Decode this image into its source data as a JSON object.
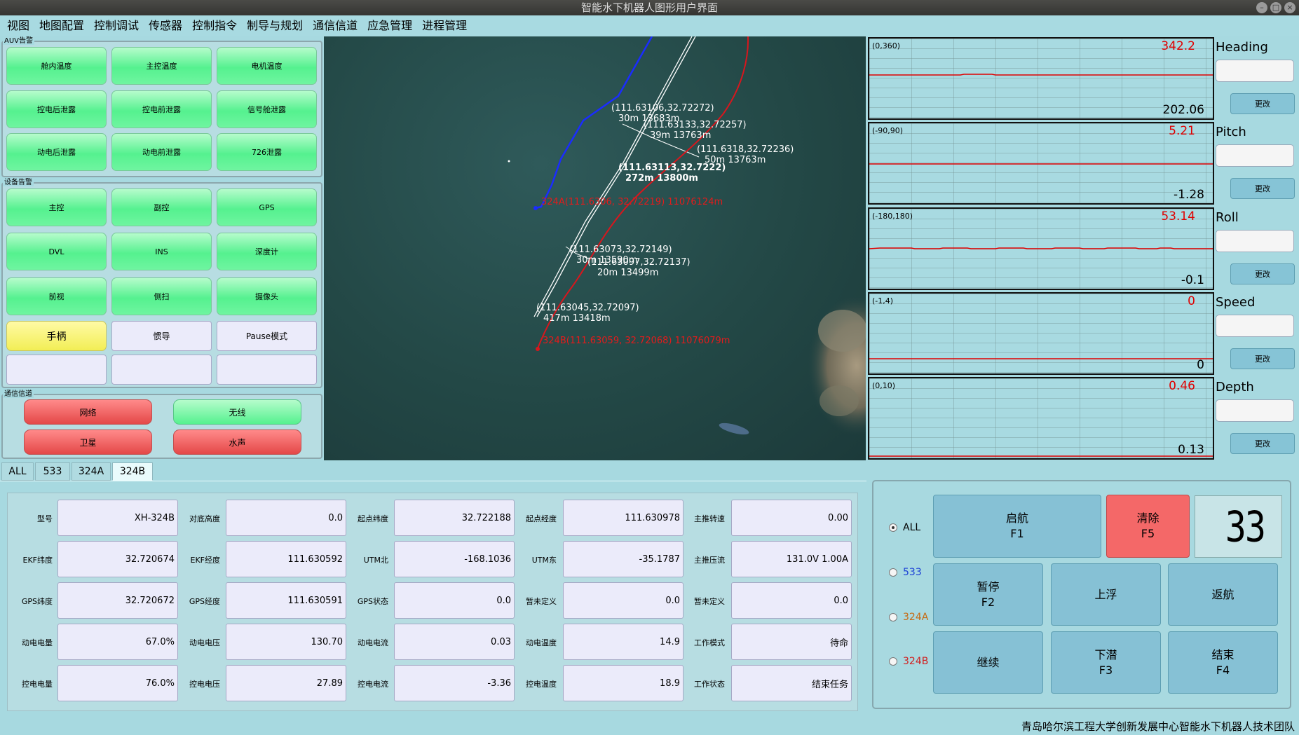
{
  "window": {
    "title": "智能水下机器人图形用户界面"
  },
  "menu": [
    "视图",
    "地图配置",
    "控制调试",
    "传感器",
    "控制指令",
    "制导与规划",
    "通信信道",
    "应急管理",
    "进程管理"
  ],
  "auv_alarm": {
    "title": "AUV告警",
    "buttons": [
      "舱内温度",
      "主控温度",
      "电机温度",
      "控电后泄露",
      "控电前泄露",
      "信号舱泄露",
      "动电后泄露",
      "动电前泄露",
      "726泄露"
    ]
  },
  "device_alarm": {
    "title": "设备告警",
    "buttons": [
      "主控",
      "副控",
      "GPS",
      "DVL",
      "INS",
      "深度计",
      "前视",
      "侧扫",
      "摄像头"
    ],
    "mode_buttons": [
      "手柄",
      "惯导",
      "Pause模式"
    ],
    "empty_buttons": [
      "",
      "",
      ""
    ]
  },
  "comm": {
    "title": "通信信道",
    "buttons": [
      {
        "label": "网络",
        "status": "red"
      },
      {
        "label": "无线",
        "status": "green"
      },
      {
        "label": "卫星",
        "status": "red"
      },
      {
        "label": "水声",
        "status": "red"
      }
    ]
  },
  "map": {
    "labels": [
      {
        "coord": "(111.63106,32.72272)",
        "info": "30m   13683m"
      },
      {
        "coord": "(111.63133,32.72257)",
        "info": "39m  13763m"
      },
      {
        "coord": "(111.6318,32.72236)",
        "info": "50m  13763m"
      },
      {
        "coord": "(111.63113,32.7222)",
        "info": "272m  13800m"
      },
      {
        "coord": "(111.63073,32.72149)",
        "info": "30m  13590m"
      },
      {
        "coord": "(111.63097,32.72137)",
        "info": "20m  13499m"
      },
      {
        "coord": "(111.63045,32.72097)",
        "info": "417m  13418m"
      }
    ],
    "vehicles": [
      {
        "text": "324A(111.6306, 32.72219) 11076124m"
      },
      {
        "text": "324B(111.63059, 32.72068) 11076079m"
      }
    ]
  },
  "sensors": [
    {
      "name": "Heading",
      "range": "(0,360)",
      "max": "342.2",
      "min": "202.06",
      "button": "更改"
    },
    {
      "name": "Pitch",
      "range": "(-90,90)",
      "max": "5.21",
      "min": "-1.28",
      "button": "更改"
    },
    {
      "name": "Roll",
      "range": "(-180,180)",
      "max": "53.14",
      "min": "-0.1",
      "button": "更改"
    },
    {
      "name": "Speed",
      "range": "(-1,4)",
      "max": "0",
      "min": "0",
      "button": "更改"
    },
    {
      "name": "Depth",
      "range": "(0,10)",
      "max": "0.46",
      "min": "0.13",
      "button": "更改"
    }
  ],
  "tabs": [
    "ALL",
    "533",
    "324A",
    "324B"
  ],
  "active_tab": "324B",
  "fields": [
    [
      {
        "label": "型号",
        "value": "XH-324B"
      },
      {
        "label": "对底高度",
        "value": "0.0"
      },
      {
        "label": "起点纬度",
        "value": "32.722188"
      },
      {
        "label": "起点经度",
        "value": "111.630978"
      },
      {
        "label": "主推转速",
        "value": "0.00"
      }
    ],
    [
      {
        "label": "EKF纬度",
        "value": "32.720674"
      },
      {
        "label": "EKF经度",
        "value": "111.630592"
      },
      {
        "label": "UTM北",
        "value": "-168.1036"
      },
      {
        "label": "UTM东",
        "value": "-35.1787"
      },
      {
        "label": "主推压流",
        "value": "131.0V 1.00A"
      }
    ],
    [
      {
        "label": "GPS纬度",
        "value": "32.720672"
      },
      {
        "label": "GPS经度",
        "value": "111.630591"
      },
      {
        "label": "GPS状态",
        "value": "0.0"
      },
      {
        "label": "暂未定义",
        "value": "0.0"
      },
      {
        "label": "暂未定义",
        "value": "0.0"
      }
    ],
    [
      {
        "label": "动电电量",
        "value": "67.0%"
      },
      {
        "label": "动电电压",
        "value": "130.70"
      },
      {
        "label": "动电电流",
        "value": "0.03"
      },
      {
        "label": "动电温度",
        "value": "14.9"
      },
      {
        "label": "工作模式",
        "value": "待命"
      }
    ],
    [
      {
        "label": "控电电量",
        "value": "76.0%"
      },
      {
        "label": "控电电压",
        "value": "27.89"
      },
      {
        "label": "控电电流",
        "value": "-3.36"
      },
      {
        "label": "控电温度",
        "value": "18.9"
      },
      {
        "label": "工作状态",
        "value": "结束任务"
      }
    ]
  ],
  "control": {
    "radios": [
      {
        "label": "ALL",
        "color": "#000000",
        "checked": true
      },
      {
        "label": "533",
        "color": "#1a3fd6",
        "checked": false
      },
      {
        "label": "324A",
        "color": "#c66a12",
        "checked": false
      },
      {
        "label": "324B",
        "color": "#d11f1f",
        "checked": false
      }
    ],
    "start": {
      "label": "启航",
      "key": "F1"
    },
    "clear": {
      "label": "清除",
      "key": "F5"
    },
    "pause": {
      "label": "暂停",
      "key": "F2"
    },
    "surface": {
      "label": "上浮",
      "key": ""
    },
    "return": {
      "label": "返航",
      "key": ""
    },
    "resume": {
      "label": "继续",
      "key": ""
    },
    "dive": {
      "label": "下潜",
      "key": "F3"
    },
    "end": {
      "label": "结束",
      "key": "F4"
    },
    "counter": "33"
  },
  "footer": "青岛哈尔滨工程大学创新发展中心智能水下机器人技术团队",
  "colors": {
    "alarm_green": "#55f18f",
    "alarm_red": "#e44848",
    "mode_yellow": "#f2ee55",
    "plot_line": "#e00000",
    "accent_red_button": "#f46868"
  }
}
